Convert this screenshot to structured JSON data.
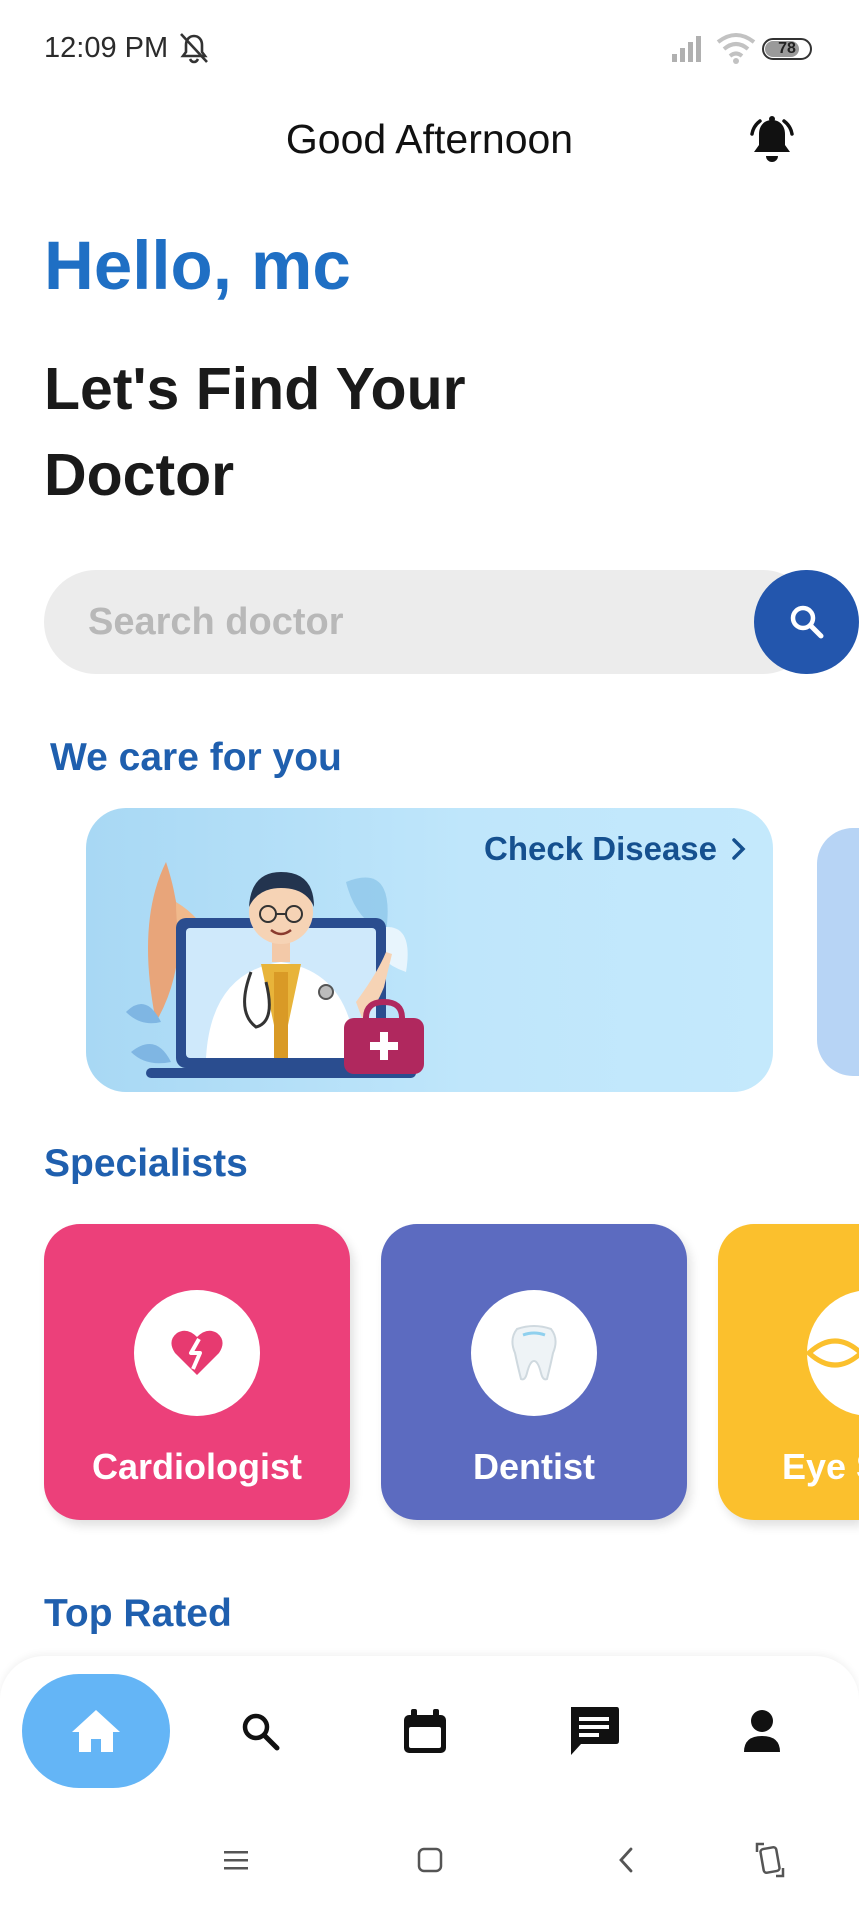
{
  "status_bar": {
    "time": "12:09 PM",
    "battery": "78",
    "icons": [
      "mute-icon",
      "signal-icon",
      "wifi-icon",
      "battery-icon"
    ]
  },
  "header": {
    "greeting": "Good Afternoon",
    "notification_icon": "bell-icon"
  },
  "hero": {
    "hello": "Hello, mc",
    "headline": "Let's Find Your Doctor"
  },
  "search": {
    "placeholder": "Search doctor",
    "value": "",
    "button_icon": "search-icon"
  },
  "care": {
    "title": "We care for you",
    "banner_link": "Check Disease",
    "banner_link_icon": "chevron-right-icon"
  },
  "specialists": {
    "title": "Specialists",
    "items": [
      {
        "label": "Cardiologist",
        "icon": "broken-heart-icon",
        "color": "#ec407a"
      },
      {
        "label": "Dentist",
        "icon": "tooth-icon",
        "color": "#5c6bc0"
      },
      {
        "label": "Eye S",
        "icon": "eye-icon",
        "color": "#fbc02d"
      }
    ]
  },
  "top_rated": {
    "title": "Top Rated"
  },
  "bottom_nav": {
    "items": [
      "home-icon",
      "search-icon",
      "calendar-icon",
      "chat-icon",
      "profile-icon"
    ],
    "active": "home-icon",
    "active_color": "#64b5f6"
  },
  "system_nav": {
    "items": [
      "menu-icon",
      "home-square-icon",
      "back-icon",
      "rotate-icon"
    ]
  },
  "colors": {
    "primary": "#1f6fc4",
    "search_button": "#2356ad"
  }
}
